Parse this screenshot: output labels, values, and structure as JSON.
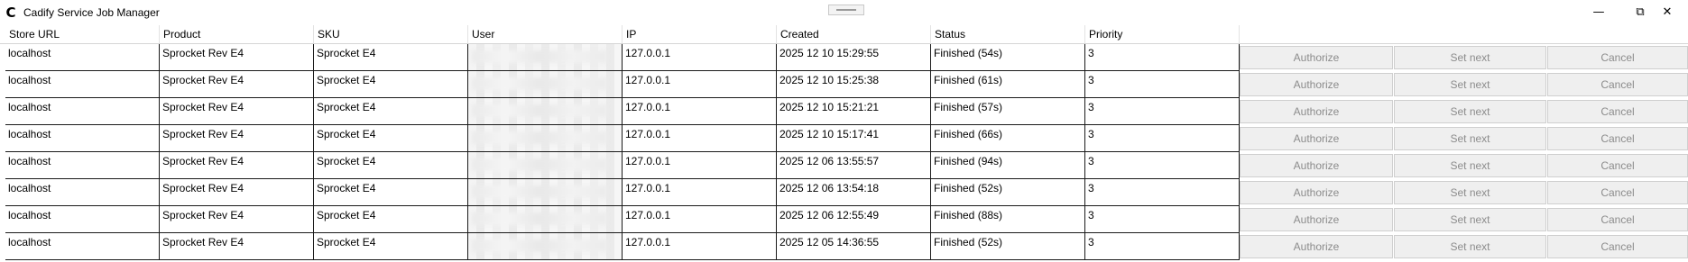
{
  "window": {
    "title": "Cadify Service Job Manager",
    "app_icon": "C",
    "minimize_glyph": "—",
    "restore_glyph": "⧉",
    "close_glyph": "✕"
  },
  "table": {
    "columns": [
      "Store URL",
      "Product",
      "SKU",
      "User",
      "IP",
      "Created",
      "Status",
      "Priority"
    ],
    "actions": {
      "authorize": "Authorize",
      "set_next": "Set next",
      "cancel": "Cancel"
    },
    "rows": [
      {
        "store_url": "localhost",
        "product": "Sprocket Rev E4",
        "sku": "Sprocket E4",
        "user": "",
        "ip": "127.0.0.1",
        "created": "2025 12 10 15:29:55",
        "status": "Finished (54s)",
        "priority": "3"
      },
      {
        "store_url": "localhost",
        "product": "Sprocket Rev E4",
        "sku": "Sprocket E4",
        "user": "",
        "ip": "127.0.0.1",
        "created": "2025 12 10 15:25:38",
        "status": "Finished (61s)",
        "priority": "3"
      },
      {
        "store_url": "localhost",
        "product": "Sprocket Rev E4",
        "sku": "Sprocket E4",
        "user": "",
        "ip": "127.0.0.1",
        "created": "2025 12 10 15:21:21",
        "status": "Finished (57s)",
        "priority": "3"
      },
      {
        "store_url": "localhost",
        "product": "Sprocket Rev E4",
        "sku": "Sprocket E4",
        "user": "",
        "ip": "127.0.0.1",
        "created": "2025 12 10 15:17:41",
        "status": "Finished (66s)",
        "priority": "3"
      },
      {
        "store_url": "localhost",
        "product": "Sprocket Rev E4",
        "sku": "Sprocket E4",
        "user": "",
        "ip": "127.0.0.1",
        "created": "2025 12 06 13:55:57",
        "status": "Finished (94s)",
        "priority": "3"
      },
      {
        "store_url": "localhost",
        "product": "Sprocket Rev E4",
        "sku": "Sprocket E4",
        "user": "",
        "ip": "127.0.0.1",
        "created": "2025 12 06 13:54:18",
        "status": "Finished (52s)",
        "priority": "3"
      },
      {
        "store_url": "localhost",
        "product": "Sprocket Rev E4",
        "sku": "Sprocket E4",
        "user": "",
        "ip": "127.0.0.1",
        "created": "2025 12 06 12:55:49",
        "status": "Finished (88s)",
        "priority": "3"
      },
      {
        "store_url": "localhost",
        "product": "Sprocket Rev E4",
        "sku": "Sprocket E4",
        "user": "",
        "ip": "127.0.0.1",
        "created": "2025 12 05 14:36:55",
        "status": "Finished (52s)",
        "priority": "3"
      }
    ]
  }
}
